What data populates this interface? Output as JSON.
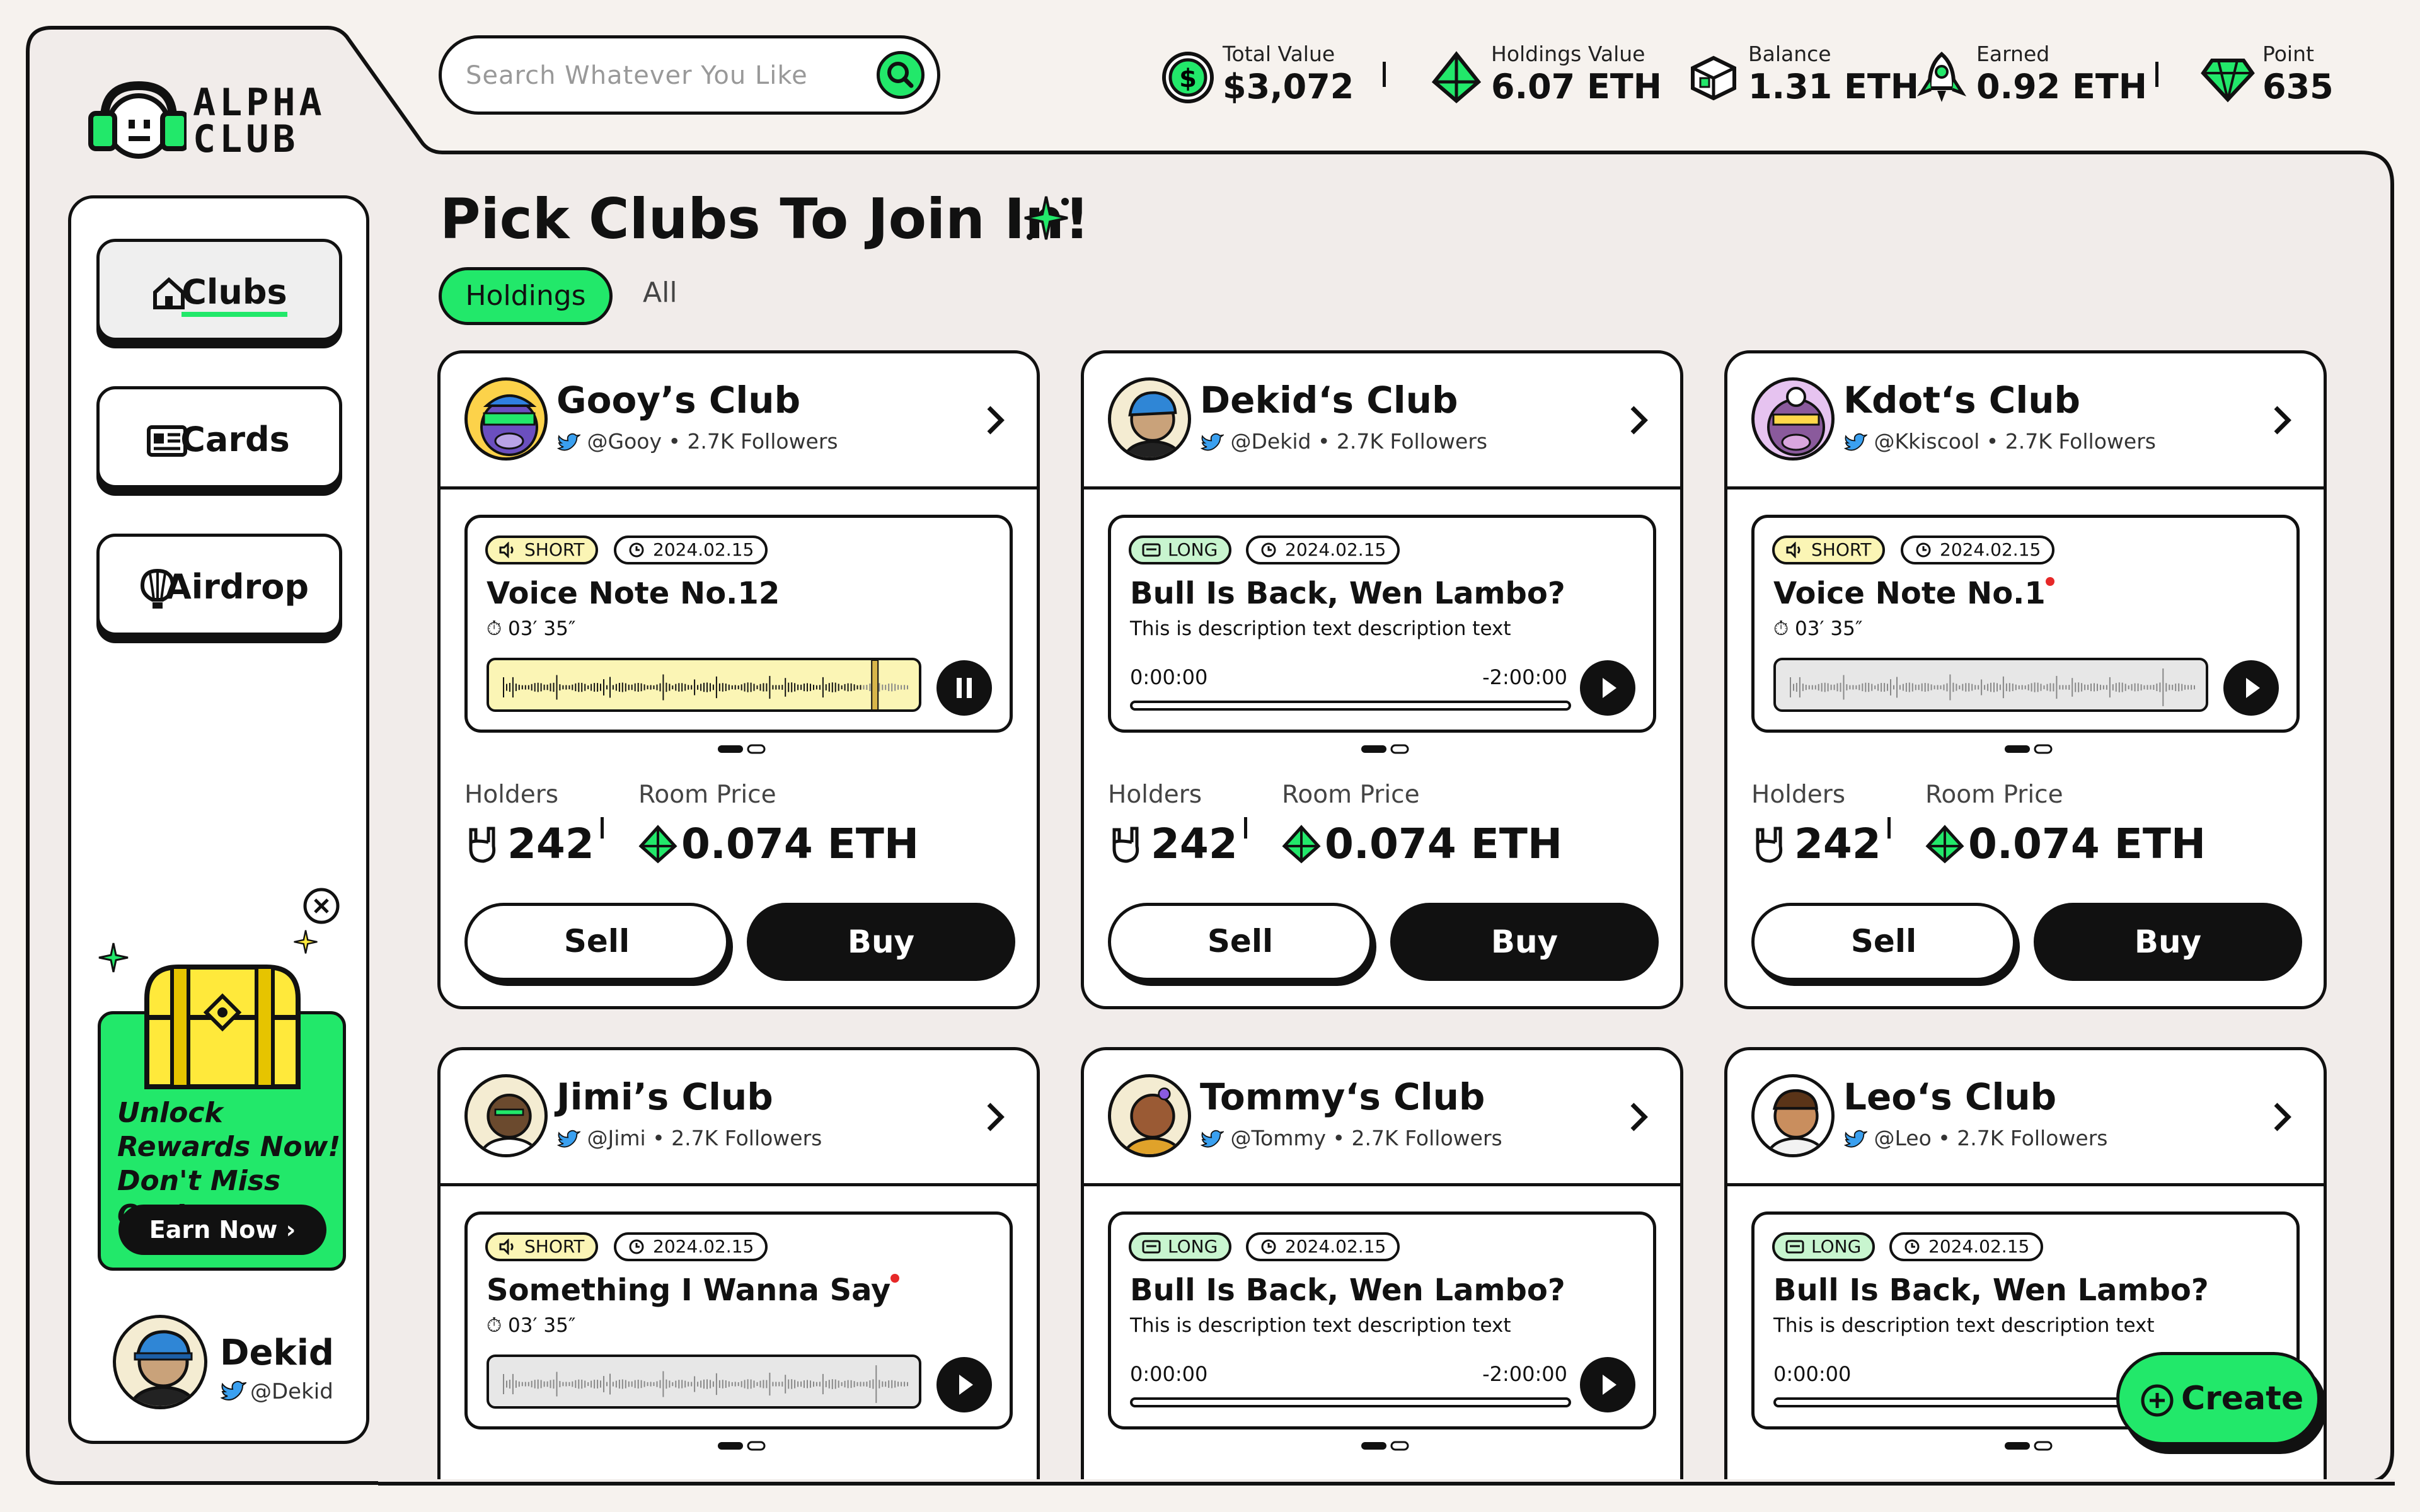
{
  "brand": {
    "line1": "ALPHA",
    "line2": "CLUB",
    "accent": "#22e86a",
    "ink": "#111111",
    "paper": "#f6f2ee"
  },
  "search": {
    "placeholder": "Search Whatever You Like",
    "icon": "search-icon"
  },
  "stats": [
    {
      "label": "Total Value",
      "value": "$3,072",
      "icon": "dollar-coin-icon"
    },
    {
      "label": "Holdings Value",
      "value": "6.07 ETH",
      "icon": "eth-diamond-icon"
    },
    {
      "label": "Balance",
      "value": "1.31 ETH",
      "icon": "cube-stack-icon"
    },
    {
      "label": "Earned",
      "value": "0.92 ETH",
      "icon": "rocket-icon"
    },
    {
      "label": "Point",
      "value": "635",
      "icon": "gem-icon"
    }
  ],
  "sidebar": {
    "nav": [
      {
        "label": "Clubs",
        "icon": "home-icon",
        "active": true
      },
      {
        "label": "Cards",
        "icon": "id-card-icon",
        "active": false
      },
      {
        "label": "Airdrop",
        "icon": "hot-air-balloon-icon",
        "active": false
      }
    ],
    "promo": {
      "line1": "Unlock",
      "line2": "Rewards Now!",
      "line3": "Don't Miss Out!",
      "cta": "Earn Now"
    },
    "user": {
      "name": "Dekid",
      "handle": "@Dekid"
    }
  },
  "main": {
    "title": "Pick Clubs To Join In!",
    "tabs": [
      {
        "label": "Holdings",
        "active": true
      },
      {
        "label": "All",
        "active": false
      }
    ],
    "clubs": [
      {
        "name": "Gooy’s Club",
        "handle": "@Gooy",
        "followers": "2.7K Followers",
        "badge": "SHORT",
        "date": "2024.02.15",
        "note_title": "Voice Note No.12",
        "duration": "03′ 35″",
        "player": "wave-playing",
        "holders_label": "Holders",
        "holders": "242",
        "price_label": "Room Price",
        "price": "0.074 ETH",
        "sell": "Sell",
        "buy": "Buy"
      },
      {
        "name": "Dekid‘s Club",
        "handle": "@Dekid",
        "followers": "2.7K Followers",
        "badge": "LONG",
        "date": "2024.02.15",
        "note_title": "Bull Is Back, Wen Lambo?",
        "description": "This is description text description text",
        "time_start": "0:00:00",
        "time_end": "-2:00:00",
        "player": "timeline",
        "holders_label": "Holders",
        "holders": "242",
        "price_label": "Room Price",
        "price": "0.074 ETH",
        "sell": "Sell",
        "buy": "Buy"
      },
      {
        "name": "Kdot‘s Club",
        "handle": "@Kkiscool",
        "followers": "2.7K Followers",
        "badge": "SHORT",
        "date": "2024.02.15",
        "note_title": "Voice Note No.1",
        "duration": "03′ 35″",
        "player": "wave",
        "holders_label": "Holders",
        "holders": "242",
        "price_label": "Room Price",
        "price": "0.074 ETH",
        "sell": "Sell",
        "buy": "Buy"
      },
      {
        "name": "Jimi’s Club",
        "handle": "@Jimi",
        "followers": "2.7K Followers",
        "badge": "SHORT",
        "date": "2024.02.15",
        "note_title": "Something I Wanna Say",
        "duration": "03′ 35″",
        "player": "wave"
      },
      {
        "name": "Tommy‘s Club",
        "handle": "@Tommy",
        "followers": "2.7K Followers",
        "badge": "LONG",
        "date": "2024.02.15",
        "note_title": "Bull Is Back, Wen Lambo?",
        "description": "This is description text description text",
        "time_start": "0:00:00",
        "time_end": "-2:00:00",
        "player": "timeline"
      },
      {
        "name": "Leo‘s Club",
        "handle": "@Leo",
        "followers": "2.7K Followers",
        "badge": "LONG",
        "date": "2024.02.15",
        "note_title": "Bull Is Back, Wen Lambo?",
        "description": "This is description text description text",
        "time_start": "0:00:00",
        "player": "timeline"
      }
    ],
    "create": "Create"
  }
}
